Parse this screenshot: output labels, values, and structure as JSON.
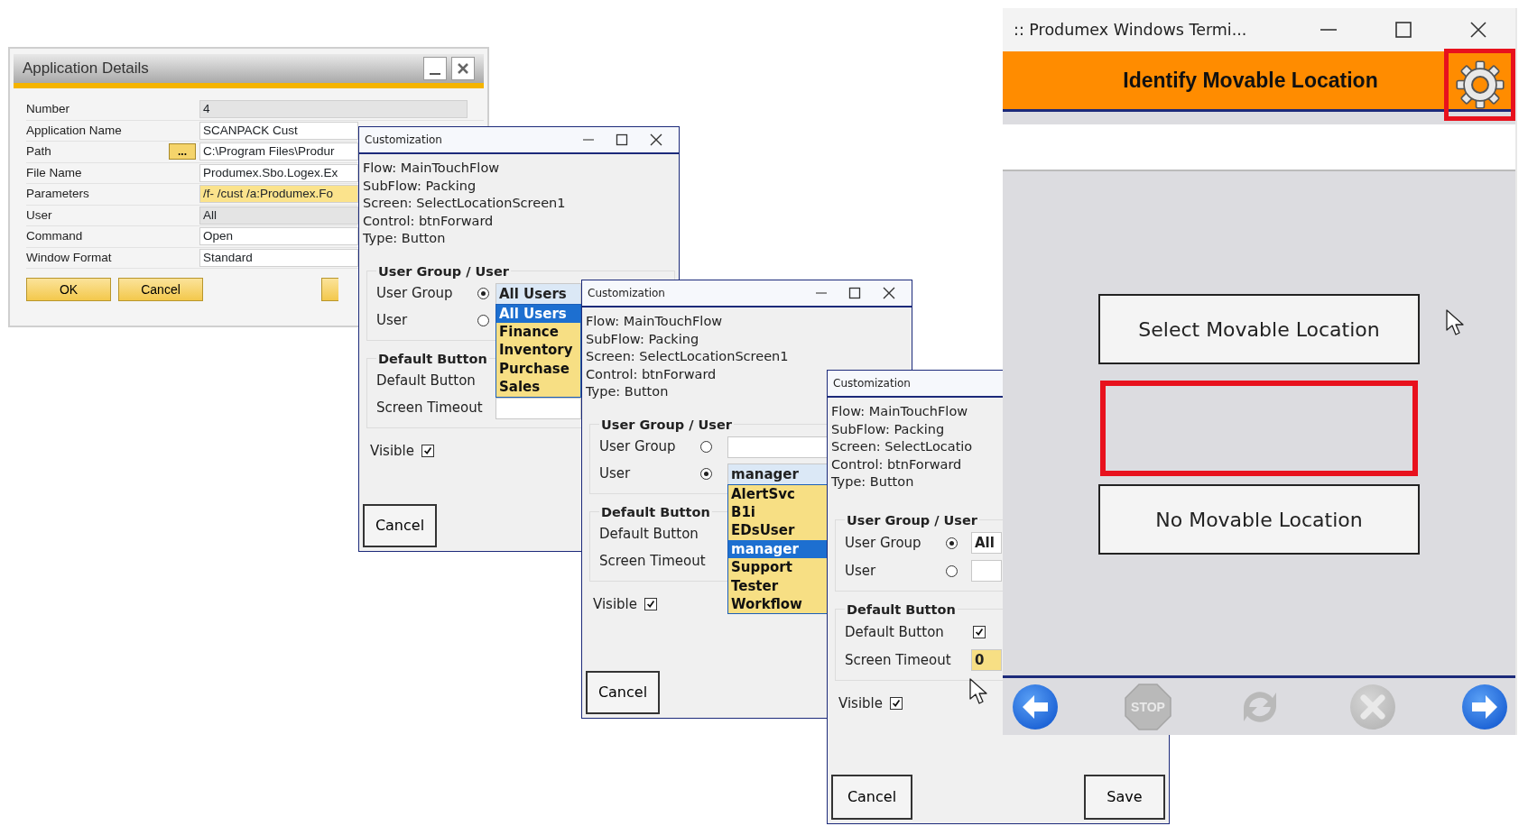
{
  "app_details": {
    "title": "Application Details",
    "fields": [
      {
        "label": "Number",
        "value": "4",
        "kind": "readonly"
      },
      {
        "label": "Application Name",
        "value": "SCANPACK Cust",
        "kind": "text"
      },
      {
        "label": "Path",
        "value": "C:\\Program Files\\Produr",
        "kind": "text",
        "browse": "..."
      },
      {
        "label": "File Name",
        "value": "Produmex.Sbo.Logex.Ex",
        "kind": "text"
      },
      {
        "label": "Parameters",
        "value": "/f- /cust /a:Produmex.Fo",
        "kind": "focused"
      },
      {
        "label": "User",
        "value": "All",
        "kind": "readonly"
      },
      {
        "label": "Command",
        "value": "Open",
        "kind": "text"
      },
      {
        "label": "Window Format",
        "value": "Standard",
        "kind": "text"
      }
    ],
    "buttons": [
      {
        "label": "OK",
        "kind": "full"
      },
      {
        "label": "Cancel",
        "kind": "full"
      },
      {
        "kind": "cut"
      }
    ]
  },
  "customizations": [
    {
      "title": "Customization",
      "controls": true,
      "info": [
        "Flow: MainTouchFlow",
        "SubFlow: Packing",
        "Screen: SelectLocationScreen1",
        "Control: btnForward",
        "Type: Button"
      ],
      "group_title": "User Group / User",
      "options": [
        {
          "label": "User Group",
          "selected": true,
          "field": {
            "kind": "combo_open",
            "value": "All Users",
            "list": [
              {
                "label": "All Users",
                "selected": true
              },
              {
                "label": "Finance",
                "selected": false
              },
              {
                "label": "Inventory",
                "selected": false
              },
              {
                "label": "Purchase",
                "selected": false
              },
              {
                "label": "Sales",
                "selected": false
              }
            ]
          }
        },
        {
          "label": "User",
          "selected": false
        }
      ],
      "default_title": "Default Button",
      "default_label": "Default Button",
      "timeout_label": "Screen Timeout",
      "timeout_field": {
        "kind": "text"
      },
      "visible_label": "Visible",
      "visible_checked": true,
      "buttons": [
        "Cancel"
      ]
    },
    {
      "title": "Customization",
      "controls": true,
      "info": [
        "Flow: MainTouchFlow",
        "SubFlow: Packing",
        "Screen: SelectLocationScreen1",
        "Control: btnForward",
        "Type: Button"
      ],
      "group_title": "User Group / User",
      "options": [
        {
          "label": "User Group",
          "selected": false,
          "field": {
            "kind": "text"
          }
        },
        {
          "label": "User",
          "selected": true,
          "field": {
            "kind": "combo_open",
            "value": "manager",
            "list": [
              {
                "label": "AlertSvc",
                "selected": false
              },
              {
                "label": "B1i",
                "selected": false
              },
              {
                "label": "EDsUser",
                "selected": false
              },
              {
                "label": "manager",
                "selected": true
              },
              {
                "label": "Support",
                "selected": false
              },
              {
                "label": "Tester",
                "selected": false
              },
              {
                "label": "Workflow",
                "selected": false
              }
            ]
          }
        }
      ],
      "default_title": "Default Button",
      "default_label": "Default Button",
      "timeout_label": "Screen Timeout",
      "visible_label": "Visible",
      "visible_checked": true,
      "buttons": [
        "Cancel"
      ]
    },
    {
      "title": "Customization",
      "controls": false,
      "info": [
        "Flow: MainTouchFlow",
        "SubFlow: Packing",
        "Screen: SelectLocatio",
        "Control: btnForward",
        "Type: Button"
      ],
      "group_title": "User Group / User",
      "options": [
        {
          "label": "User Group",
          "selected": true,
          "field": {
            "kind": "combo",
            "value": "All"
          }
        },
        {
          "label": "User",
          "selected": false,
          "field": {
            "kind": "text"
          }
        }
      ],
      "default_title": "Default Button",
      "default_label": "Default Button",
      "default_checked": true,
      "timeout_label": "Screen Timeout",
      "timeout_field": {
        "kind": "focused",
        "value": "0"
      },
      "visible_label": "Visible",
      "visible_checked": true,
      "buttons": [
        "Cancel",
        "Save"
      ]
    }
  ],
  "terminal": {
    "title": ":: Produmex Windows Termi...",
    "header": "Identify Movable Location",
    "gear_highlighted": true,
    "buttons": [
      {
        "label": "Select Movable Location",
        "highlighted": false
      },
      {
        "highlighted": true
      },
      {
        "label": "No Movable Location",
        "highlighted": false
      }
    ],
    "toolbar": [
      {
        "kind": "back",
        "disabled": false
      },
      {
        "kind": "stop",
        "label": "STOP",
        "disabled": true
      },
      {
        "kind": "refresh",
        "disabled": true
      },
      {
        "kind": "cancel",
        "disabled": true
      },
      {
        "kind": "forward",
        "disabled": false
      }
    ]
  }
}
